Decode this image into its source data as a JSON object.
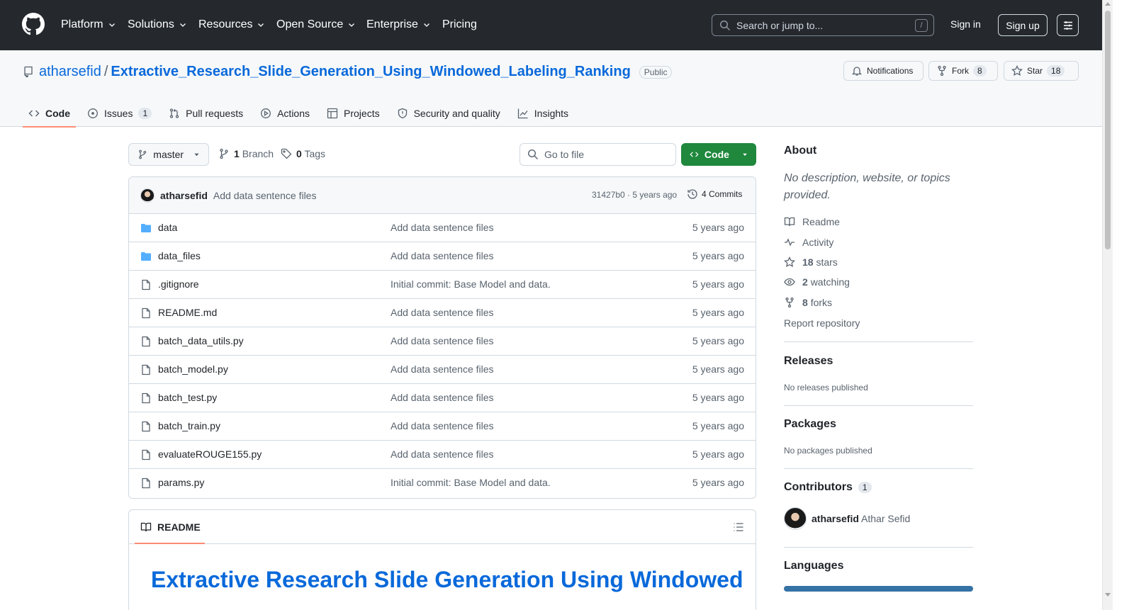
{
  "nav": {
    "items": [
      {
        "label": "Platform",
        "has_menu": true
      },
      {
        "label": "Solutions",
        "has_menu": true
      },
      {
        "label": "Resources",
        "has_menu": true
      },
      {
        "label": "Open Source",
        "has_menu": true
      },
      {
        "label": "Enterprise",
        "has_menu": true
      },
      {
        "label": "Pricing",
        "has_menu": false
      }
    ],
    "search_placeholder": "Search or jump to...",
    "search_shortcut": "/",
    "sign_in": "Sign in",
    "sign_up": "Sign up"
  },
  "repo": {
    "owner": "atharsefid",
    "separator": "/",
    "name": "Extractive_Research_Slide_Generation_Using_Windowed_Labeling_Ranking",
    "visibility": "Public",
    "notifications_label": "Notifications",
    "fork_label": "Fork",
    "fork_count": "8",
    "star_label": "Star",
    "star_count": "18"
  },
  "tabs": [
    {
      "label": "Code",
      "icon": "code-icon",
      "active": true
    },
    {
      "label": "Issues",
      "icon": "issue-icon",
      "count": "1"
    },
    {
      "label": "Pull requests",
      "icon": "pull-request-icon"
    },
    {
      "label": "Actions",
      "icon": "play-icon"
    },
    {
      "label": "Projects",
      "icon": "table-icon"
    },
    {
      "label": "Security and quality",
      "icon": "shield-icon"
    },
    {
      "label": "Insights",
      "icon": "graph-icon"
    }
  ],
  "toolbar": {
    "branch": "master",
    "branch_count": "1",
    "branch_label": "Branch",
    "tag_count": "0",
    "tag_label": "Tags",
    "go_to_file": "Go to file",
    "code_button": "Code"
  },
  "latest_commit": {
    "author": "atharsefid",
    "message": "Add data sentence files",
    "hash_time": "31427b0 · 5 years ago",
    "commits_label": "4 Commits"
  },
  "files": [
    {
      "name": "data",
      "type": "folder",
      "commit": "Add data sentence files",
      "date": "5 years ago"
    },
    {
      "name": "data_files",
      "type": "folder",
      "commit": "Add data sentence files",
      "date": "5 years ago"
    },
    {
      "name": ".gitignore",
      "type": "file",
      "commit": "Initial commit: Base Model and data.",
      "date": "5 years ago"
    },
    {
      "name": "README.md",
      "type": "file",
      "commit": "Add data sentence files",
      "date": "5 years ago"
    },
    {
      "name": "batch_data_utils.py",
      "type": "file",
      "commit": "Add data sentence files",
      "date": "5 years ago"
    },
    {
      "name": "batch_model.py",
      "type": "file",
      "commit": "Add data sentence files",
      "date": "5 years ago"
    },
    {
      "name": "batch_test.py",
      "type": "file",
      "commit": "Add data sentence files",
      "date": "5 years ago"
    },
    {
      "name": "batch_train.py",
      "type": "file",
      "commit": "Add data sentence files",
      "date": "5 years ago"
    },
    {
      "name": "evaluateROUGE155.py",
      "type": "file",
      "commit": "Add data sentence files",
      "date": "5 years ago"
    },
    {
      "name": "params.py",
      "type": "file",
      "commit": "Initial commit: Base Model and data.",
      "date": "5 years ago"
    }
  ],
  "readme": {
    "tab_label": "README",
    "heading": "Extractive Research Slide Generation Using Windowed"
  },
  "sidebar": {
    "about_title": "About",
    "about_desc": "No description, website, or topics provided.",
    "links": {
      "readme": "Readme",
      "activity": "Activity",
      "stars_count": "18",
      "stars_label": "stars",
      "watching_count": "2",
      "watching_label": "watching",
      "forks_count": "8",
      "forks_label": "forks",
      "report": "Report repository"
    },
    "releases_title": "Releases",
    "releases_empty": "No releases published",
    "packages_title": "Packages",
    "packages_empty": "No packages published",
    "contributors_title": "Contributors",
    "contributors_count": "1",
    "contributor_login": "atharsefid",
    "contributor_name": "Athar Sefid",
    "languages_title": "Languages"
  },
  "colors": {
    "header_bg": "#25292e",
    "link": "#0969da",
    "code_button": "#1f883d",
    "active_tab_underline": "#fd8c73",
    "language_python": "#3572a5"
  }
}
